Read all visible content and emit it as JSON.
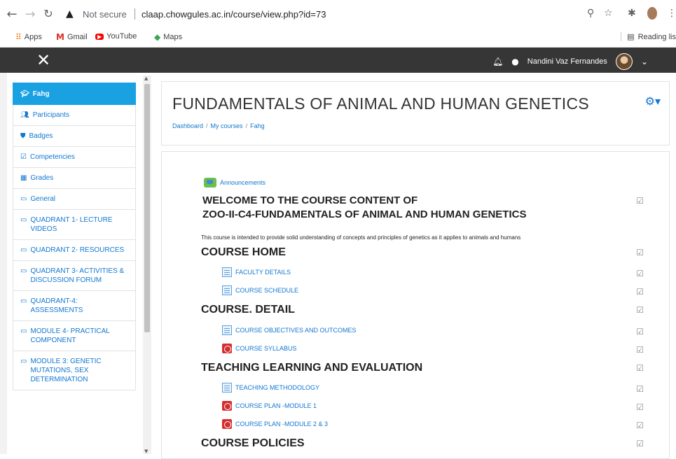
{
  "browser": {
    "security_label": "Not secure",
    "url": "claap.chowgules.ac.in/course/view.php?id=73",
    "bookmarks": [
      "Apps",
      "Gmail",
      "YouTube",
      "Maps"
    ],
    "reading_list": "Reading lis"
  },
  "navbar": {
    "user_name": "Nandini Vaz Fernandes"
  },
  "sidebar": {
    "items": [
      {
        "label": "Fahg",
        "icon": "graduation-cap-icon"
      },
      {
        "label": "Participants",
        "icon": "users-icon"
      },
      {
        "label": "Badges",
        "icon": "shield-icon"
      },
      {
        "label": "Competencies",
        "icon": "checkbox-icon"
      },
      {
        "label": "Grades",
        "icon": "table-icon"
      },
      {
        "label": "General",
        "icon": "folder-icon"
      },
      {
        "label": "QUADRANT 1- LECTURE VIDEOS",
        "icon": "folder-icon"
      },
      {
        "label": "QUADRANT 2- RESOURCES",
        "icon": "folder-icon"
      },
      {
        "label": "QUADRANT 3- ACTIVITIES & DISCUSSION FORUM",
        "icon": "folder-icon"
      },
      {
        "label": "QUADRANT-4: ASSESSMENTS",
        "icon": "folder-icon"
      },
      {
        "label": "MODULE 4- PRACTICAL COMPONENT",
        "icon": "folder-icon"
      },
      {
        "label": "MODULE 3: GENETIC MUTATIONS, SEX DETERMINATION",
        "icon": "folder-icon"
      }
    ]
  },
  "header": {
    "title": "FUNDAMENTALS OF ANIMAL AND HUMAN GENETICS",
    "breadcrumb": [
      "Dashboard",
      "My courses",
      "Fahg"
    ]
  },
  "content": {
    "announcements": "Announcements",
    "welcome_line1": "WELCOME TO THE COURSE CONTENT OF",
    "welcome_line2": "ZOO-II-C4-FUNDAMENTALS OF ANIMAL AND HUMAN GENETICS",
    "intro": "This course is intended to provide solid understanding of concepts and principles of genetics as it applies to animals and humans",
    "course_home": "COURSE HOME",
    "faculty_details": "FACULTY DETAILS",
    "course_schedule": "COURSE SCHEDULE",
    "course_detail": "COURSE. DETAIL",
    "objectives": "COURSE OBJECTIVES AND OUTCOMES",
    "syllabus": "COURSE SYLLABUS",
    "tle": "TEACHING LEARNING AND EVALUATION",
    "methodology": "TEACHING METHODOLOGY",
    "plan1": "COURSE PLAN -MODULE 1",
    "plan23": "COURSE PLAN -MODULE 2 & 3",
    "policies": "COURSE POLICIES"
  }
}
